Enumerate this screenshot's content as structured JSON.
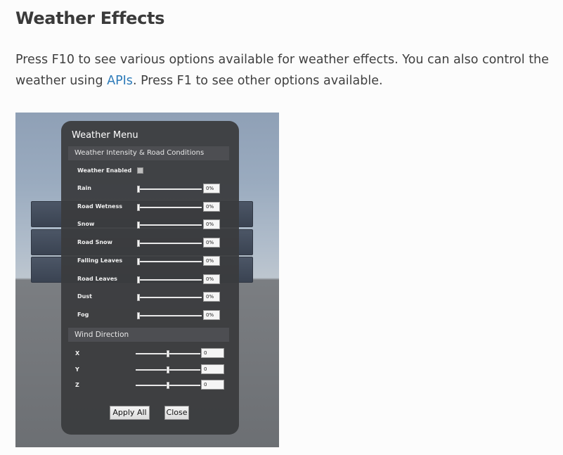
{
  "heading": "Weather Effects",
  "paragraph": {
    "before_link": "Press F10 to see various options available for weather effects. You can also control the weather using ",
    "link": "APIs",
    "after_link": ". Press F1 to see other options available."
  },
  "colors": {
    "link": "#2c7ab8",
    "menu_background": "#3a3b3e",
    "section_header": "#4d4e52"
  },
  "weather_menu": {
    "title": "Weather Menu",
    "intensity_section": "Weather Intensity & Road Conditions",
    "weather_enabled_label": "Weather Enabled",
    "weather_enabled_checked": false,
    "sliders": [
      {
        "label": "Rain",
        "value": "0%",
        "level": 0
      },
      {
        "label": "Road Wetness",
        "value": "0%",
        "level": 0
      },
      {
        "label": "Snow",
        "value": "0%",
        "level": 0
      },
      {
        "label": "Road Snow",
        "value": "0%",
        "level": 0
      },
      {
        "label": "Falling Leaves",
        "value": "0%",
        "level": 0
      },
      {
        "label": "Road Leaves",
        "value": "0%",
        "level": 0
      },
      {
        "label": "Dust",
        "value": "0%",
        "level": 0
      },
      {
        "label": "Fog",
        "value": "0%",
        "level": 0
      }
    ],
    "wind_section": "Wind Direction",
    "wind": [
      {
        "label": "X",
        "value": "0",
        "level": 0.5
      },
      {
        "label": "Y",
        "value": "0",
        "level": 0.5
      },
      {
        "label": "Z",
        "value": "0",
        "level": 0.5
      }
    ],
    "apply_button": "Apply All",
    "close_button": "Close"
  }
}
